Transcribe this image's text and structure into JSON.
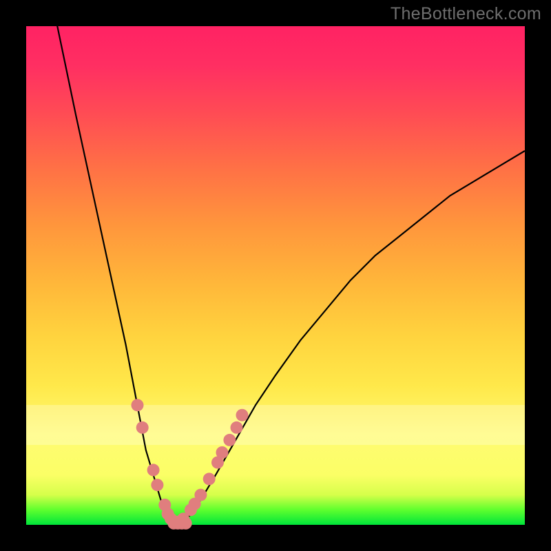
{
  "watermark": "TheBottleneck.com",
  "chart_data": {
    "type": "line",
    "title": "",
    "xlabel": "",
    "ylabel": "",
    "xlim": [
      0,
      100
    ],
    "ylim": [
      0,
      100
    ],
    "grid": false,
    "series": [
      {
        "name": "curve",
        "x": [
          0,
          5,
          10,
          15,
          20,
          24,
          27,
          29,
          30,
          31,
          33,
          35,
          38,
          42,
          46,
          50,
          55,
          60,
          65,
          70,
          75,
          80,
          85,
          90,
          95,
          100
        ],
        "values": [
          130,
          106,
          82,
          59,
          36,
          15,
          5,
          1,
          0,
          0.5,
          2,
          5,
          10,
          17,
          24,
          30,
          37,
          43,
          49,
          54,
          58,
          62,
          66,
          69,
          72,
          75
        ],
        "color": "#000000",
        "weight": 2
      },
      {
        "name": "left-dots",
        "x": [
          22.3,
          23.3,
          25.5,
          26.3,
          27.8,
          28.4,
          29.0,
          29.6
        ],
        "values": [
          24,
          19.5,
          11,
          8,
          4,
          2.2,
          1.2,
          0.6
        ],
        "color": "#e07e7e",
        "marker_radius": 9
      },
      {
        "name": "right-dots",
        "x": [
          30.2,
          30.8,
          31.5,
          33.0,
          33.8,
          35.0,
          36.7,
          38.4,
          39.3,
          40.8,
          42.2,
          43.3
        ],
        "values": [
          0.6,
          0.5,
          1.2,
          3.0,
          4.2,
          6.0,
          9.2,
          12.5,
          14.5,
          17.0,
          19.5,
          22.0
        ],
        "color": "#e07e7e",
        "marker_radius": 9
      },
      {
        "name": "bottom-dots",
        "x": [
          29.6,
          30.4,
          31.2,
          32.0
        ],
        "values": [
          0.3,
          0.3,
          0.3,
          0.3
        ],
        "color": "#e07e7e",
        "marker_radius": 9
      }
    ],
    "bands": [
      {
        "y0": 16,
        "y1": 24,
        "alpha": 0.25
      }
    ]
  }
}
